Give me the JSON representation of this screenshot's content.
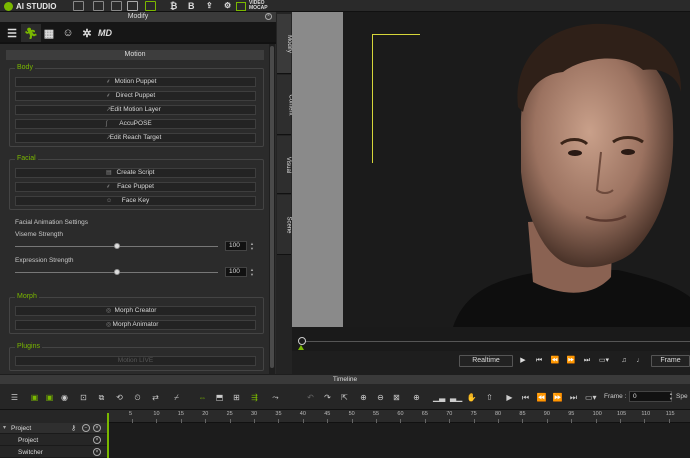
{
  "app": {
    "name": "AI STUDIO",
    "video_mocap_line1": "VIDEO",
    "video_mocap_line2": "MOCAP",
    "bold_b": "B"
  },
  "modify_panel": {
    "title": "Modify",
    "tabs": [
      {
        "icon": "sliders-icon"
      },
      {
        "icon": "running-figure-icon",
        "active": true
      },
      {
        "icon": "checker-icon"
      },
      {
        "icon": "head-icon"
      },
      {
        "icon": "gear-face-icon"
      },
      {
        "icon": "md-logo-icon",
        "text": "MD"
      }
    ],
    "section_title": "Motion",
    "body": {
      "label": "Body",
      "buttons": [
        "Motion Puppet",
        "Direct Puppet",
        "Edit Motion Layer",
        "AccuPOSE",
        "Edit Reach Target"
      ]
    },
    "facial": {
      "label": "Facial",
      "buttons": [
        "Create Script",
        "Face Puppet",
        "Face Key"
      ]
    },
    "facial_settings": {
      "label": "Facial Animation Settings",
      "viseme_label": "Viseme Strength",
      "viseme_value": "100",
      "viseme_level": 0.5,
      "expression_label": "Expression Strength",
      "expression_value": "100",
      "expression_level": 0.5
    },
    "morph": {
      "label": "Morph",
      "buttons": [
        "Morph Creator",
        "Morph Animator"
      ]
    },
    "plugins": {
      "label": "Plugins",
      "buttons": [
        "Motion LIVE"
      ]
    }
  },
  "side_tabs": [
    "Modify",
    "Content",
    "Visual",
    "Scene"
  ],
  "playback": {
    "realtime_label": "Realtime",
    "frame_label": "Frame"
  },
  "timeline": {
    "title": "Timeline",
    "frame_label": "Frame :",
    "frame_value": "0",
    "speed_label": "Spe",
    "ruler_ticks": [
      "5",
      "10",
      "15",
      "20",
      "25",
      "30",
      "35",
      "40",
      "45",
      "50",
      "55",
      "60",
      "65",
      "70",
      "75",
      "80",
      "85",
      "90",
      "95",
      "100",
      "105",
      "110",
      "115"
    ],
    "rows": [
      {
        "label": "Project"
      },
      {
        "label": "Project"
      },
      {
        "label": "Switcher"
      }
    ]
  }
}
